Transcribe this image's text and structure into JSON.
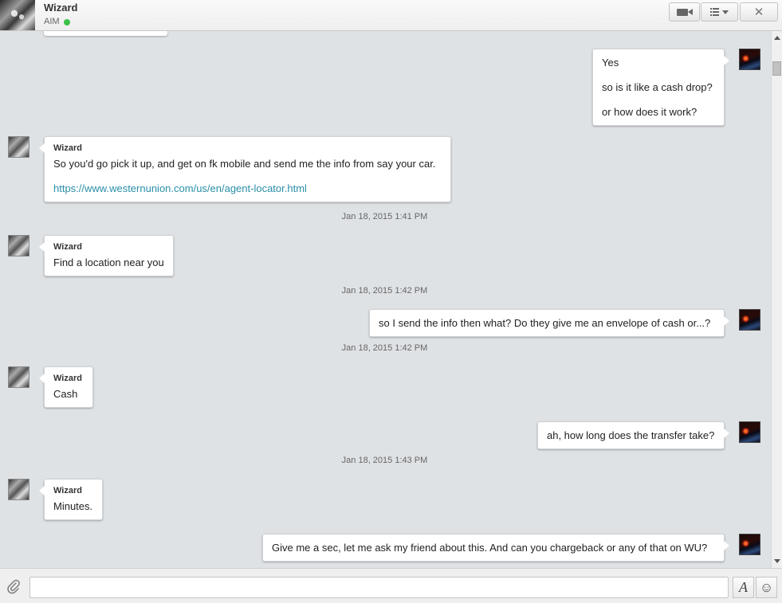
{
  "header": {
    "contact_name": "Wizard",
    "service": "AIM",
    "status_color": "#3cc14a",
    "icons": [
      "video-call-icon",
      "list-menu-icon",
      "chevron-down-icon",
      "close-icon"
    ],
    "close_glyph": "✕"
  },
  "messages": [
    {
      "dir": "out",
      "lines": [
        "Yes",
        "so is it like a cash drop?",
        "or how does it work?"
      ]
    },
    {
      "dir": "in",
      "sender": "Wizard",
      "lines": [
        "So you'd go pick it up, and get on fk mobile and send me the info from say your car."
      ],
      "link": "https://www.westernunion.com/us/en/agent-locator.html"
    },
    {
      "timestamp": "Jan 18, 2015 1:41 PM"
    },
    {
      "dir": "in",
      "sender": "Wizard",
      "lines": [
        "Find a location near you"
      ]
    },
    {
      "timestamp": "Jan 18, 2015 1:42 PM"
    },
    {
      "dir": "out",
      "lines": [
        "so I send the info then what? Do they give me an envelope of cash or...?"
      ]
    },
    {
      "timestamp": "Jan 18, 2015 1:42 PM"
    },
    {
      "dir": "in",
      "sender": "Wizard",
      "lines": [
        "Cash"
      ]
    },
    {
      "dir": "out",
      "lines": [
        "ah, how long does the transfer take?"
      ]
    },
    {
      "timestamp": "Jan 18, 2015 1:43 PM"
    },
    {
      "dir": "in",
      "sender": "Wizard",
      "lines": [
        "Minutes."
      ]
    },
    {
      "dir": "out",
      "lines": [
        "Give me a sec, let me ask my friend about this. And can you chargeback or any of that on WU?"
      ]
    }
  ],
  "composer": {
    "value": "",
    "format_glyph": "A",
    "emoji_glyph": "☺",
    "icons": [
      "attachment-icon",
      "text-format-icon",
      "emoji-icon"
    ]
  },
  "colors": {
    "chat_background": "#dfe2e5",
    "link": "#2a8fa8"
  }
}
